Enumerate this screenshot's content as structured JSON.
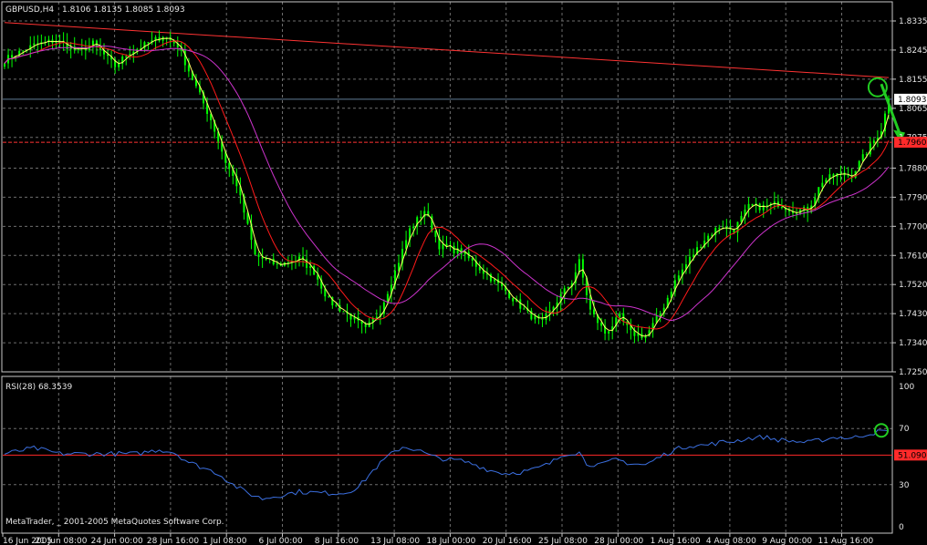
{
  "header": {
    "symbol": "GBPUSD,H4",
    "ohlc": "1.8106 1.8135 1.8085 1.8093"
  },
  "footer": {
    "copyright": "MetaTrader, _ 2001-2005 MetaQuotes Software Corp."
  },
  "colors": {
    "background": "#000000",
    "grid": "#6e6e6e",
    "frame": "#c8c8c8",
    "candles": "#00ff00",
    "ma_fast": "#ffff66",
    "ma_mid": "#ff1a1a",
    "ma_slow": "#cc33cc",
    "trendline": "#ff3333",
    "current_price_line": "#5f7d96",
    "rsi_line": "#3b6fe0",
    "rsi_level": "#ff2a2a",
    "annotation": "#22cc22",
    "price_tag_bg": "#ffffff",
    "level_tag_bg": "#ff2a2a"
  },
  "chart_data": {
    "type": "candlestick",
    "symbol": "GBPUSD",
    "timeframe": "H4",
    "ylim": [
      1.7238,
      1.8395
    ],
    "y_ticks": [
      "1.8335",
      "1.8245",
      "1.8155",
      "1.8065",
      "1.7975",
      "1.7880",
      "1.7790",
      "1.7700",
      "1.7610",
      "1.7520",
      "1.7430",
      "1.7340",
      "1.7250"
    ],
    "x_ticks": [
      "16 Jun 2005",
      "21 Jun 08:00",
      "24 Jun 00:00",
      "28 Jun 16:00",
      "1 Jul 08:00",
      "6 Jul 00:00",
      "8 Jul 16:00",
      "13 Jul 08:00",
      "18 Jul 00:00",
      "20 Jul 16:00",
      "25 Jul 08:00",
      "28 Jul 00:00",
      "1 Aug 16:00",
      "4 Aug 08:00",
      "9 Aug 00:00",
      "11 Aug 16:00"
    ],
    "close_keypoints": [
      [
        0,
        1.8215
      ],
      [
        8,
        1.826
      ],
      [
        14,
        1.8275
      ],
      [
        20,
        1.824
      ],
      [
        24,
        1.8265
      ],
      [
        30,
        1.8195
      ],
      [
        34,
        1.824
      ],
      [
        40,
        1.827
      ],
      [
        43,
        1.829
      ],
      [
        47,
        1.826
      ],
      [
        52,
        1.813
      ],
      [
        56,
        1.803
      ],
      [
        60,
        1.79
      ],
      [
        63,
        1.783
      ],
      [
        66,
        1.77
      ],
      [
        68,
        1.761
      ],
      [
        74,
        1.758
      ],
      [
        80,
        1.76
      ],
      [
        84,
        1.756
      ],
      [
        88,
        1.747
      ],
      [
        94,
        1.742
      ],
      [
        98,
        1.738
      ],
      [
        102,
        1.744
      ],
      [
        106,
        1.756
      ],
      [
        110,
        1.769
      ],
      [
        114,
        1.775
      ],
      [
        118,
        1.764
      ],
      [
        124,
        1.762
      ],
      [
        130,
        1.756
      ],
      [
        136,
        1.75
      ],
      [
        142,
        1.743
      ],
      [
        146,
        1.74
      ],
      [
        150,
        1.747
      ],
      [
        154,
        1.753
      ],
      [
        156,
        1.759
      ],
      [
        159,
        1.744
      ],
      [
        163,
        1.737
      ],
      [
        167,
        1.742
      ],
      [
        170,
        1.737
      ],
      [
        174,
        1.736
      ],
      [
        178,
        1.743
      ],
      [
        182,
        1.753
      ],
      [
        186,
        1.76
      ],
      [
        190,
        1.766
      ],
      [
        194,
        1.77
      ],
      [
        198,
        1.769
      ],
      [
        202,
        1.776
      ],
      [
        206,
        1.776
      ],
      [
        210,
        1.777
      ],
      [
        214,
        1.775
      ],
      [
        218,
        1.775
      ],
      [
        222,
        1.784
      ],
      [
        226,
        1.786
      ],
      [
        230,
        1.786
      ],
      [
        234,
        1.793
      ],
      [
        238,
        1.8
      ],
      [
        240,
        1.8093
      ]
    ],
    "moving_averages": [
      {
        "style": "yellow",
        "period": 3
      },
      {
        "style": "red",
        "period": 10
      },
      {
        "style": "magenta",
        "period": 24
      }
    ],
    "trendline": {
      "from": [
        0,
        1.833
      ],
      "to": [
        240,
        1.816
      ]
    },
    "horizontal_levels": [
      {
        "price": 1.8093,
        "label": "1.8093",
        "kind": "current_price"
      },
      {
        "price": 1.796,
        "label": "1.7960",
        "kind": "level"
      }
    ],
    "annotations": [
      {
        "kind": "circle",
        "bar": 237,
        "price": 1.813
      },
      {
        "kind": "arrow",
        "from": [
          238,
          1.814
        ],
        "to": [
          241,
          1.797
        ]
      }
    ],
    "rsi": {
      "title": "RSI(28) 68.3539",
      "period": 28,
      "last": 68.3539,
      "ylim": [
        0,
        100
      ],
      "ticks": [
        "100",
        "70",
        "30",
        "0"
      ],
      "level": {
        "value": 51.09,
        "label": "51.090"
      },
      "keypoints": [
        [
          0,
          52
        ],
        [
          8,
          56
        ],
        [
          15,
          52
        ],
        [
          22,
          52
        ],
        [
          30,
          52
        ],
        [
          36,
          52
        ],
        [
          42,
          55
        ],
        [
          46,
          53
        ],
        [
          50,
          46
        ],
        [
          54,
          42
        ],
        [
          58,
          38
        ],
        [
          62,
          30
        ],
        [
          66,
          24
        ],
        [
          70,
          20
        ],
        [
          74,
          22
        ],
        [
          80,
          25
        ],
        [
          86,
          24
        ],
        [
          92,
          24
        ],
        [
          96,
          28
        ],
        [
          100,
          40
        ],
        [
          104,
          50
        ],
        [
          108,
          57
        ],
        [
          112,
          55
        ],
        [
          116,
          50
        ],
        [
          120,
          48
        ],
        [
          124,
          47
        ],
        [
          128,
          44
        ],
        [
          132,
          40
        ],
        [
          136,
          38
        ],
        [
          140,
          39
        ],
        [
          144,
          41
        ],
        [
          148,
          45
        ],
        [
          152,
          52
        ],
        [
          156,
          53
        ],
        [
          158,
          45
        ],
        [
          162,
          44
        ],
        [
          166,
          48
        ],
        [
          170,
          45
        ],
        [
          174,
          44
        ],
        [
          178,
          50
        ],
        [
          182,
          55
        ],
        [
          186,
          58
        ],
        [
          190,
          58
        ],
        [
          194,
          60
        ],
        [
          198,
          61
        ],
        [
          202,
          63
        ],
        [
          206,
          64
        ],
        [
          210,
          62
        ],
        [
          214,
          61
        ],
        [
          218,
          60
        ],
        [
          222,
          62
        ],
        [
          226,
          64
        ],
        [
          230,
          63
        ],
        [
          234,
          66
        ],
        [
          238,
          68
        ],
        [
          240,
          68.35
        ]
      ],
      "annotation": {
        "kind": "circle",
        "bar": 240,
        "value": 70
      }
    }
  }
}
